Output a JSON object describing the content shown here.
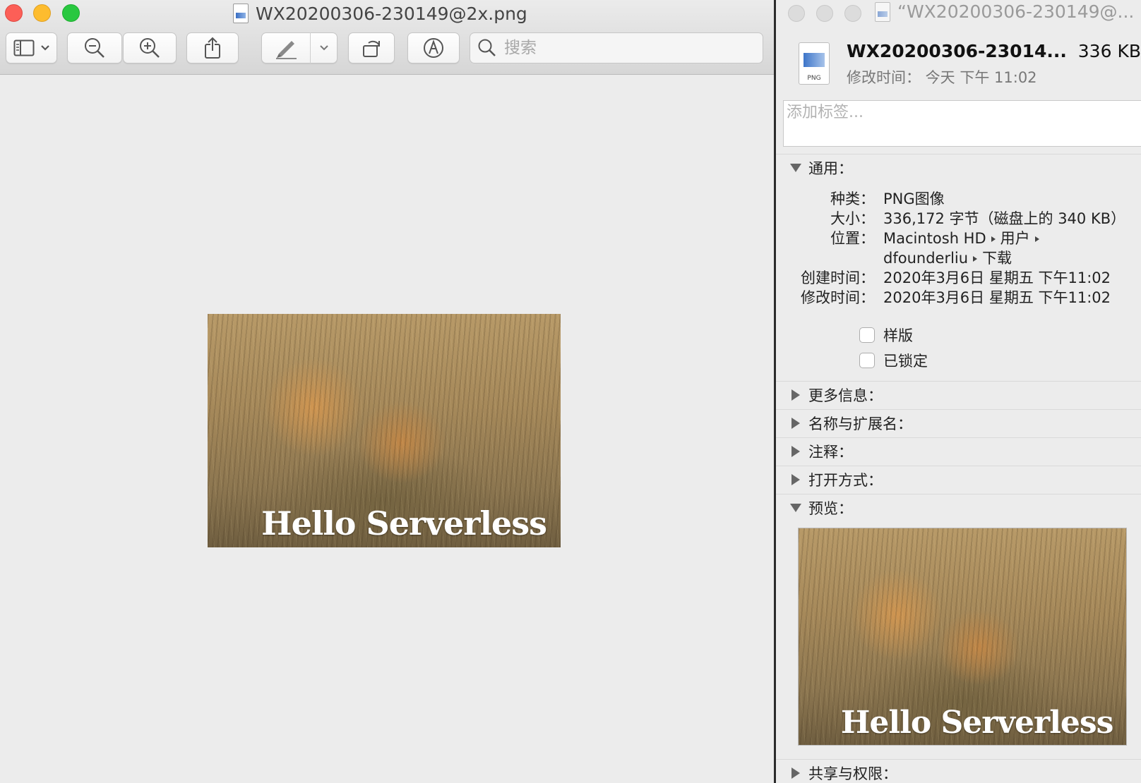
{
  "preview": {
    "title": "WX20200306-230149@2x.png",
    "search_placeholder": "搜索",
    "image_caption": "Hello Serverless",
    "toolbar_icons": [
      "sidebar-toggle-icon",
      "chevron-down-icon",
      "zoom-out-icon",
      "zoom-in-icon",
      "share-icon",
      "markup-pen-icon",
      "chevron-down-icon",
      "rotate-icon",
      "annotate-icon",
      "search-icon"
    ]
  },
  "inspector": {
    "title": "“WX20200306-230149@...",
    "file_name": "WX20200306-23014...",
    "file_size": "336 KB",
    "modified_summary": "修改时间： 今天 下午 11:02",
    "file_badge": "PNG",
    "tags_placeholder": "添加标签...",
    "general": {
      "header": "通用：",
      "kind_label": "种类：",
      "kind_value": "PNG图像",
      "size_label": "大小：",
      "size_value": "336,172 字节（磁盘上的 340 KB）",
      "where_label": "位置：",
      "where_part1": "Macintosh HD",
      "where_part2": "用户",
      "where_part3": "dfounderliu",
      "where_part4": "下载",
      "created_label": "创建时间：",
      "created_value": "2020年3月6日 星期五 下午11:02",
      "modified_label": "修改时间：",
      "modified_value": "2020年3月6日 星期五 下午11:02",
      "stationery_label": "样版",
      "stationery_checked": false,
      "locked_label": "已锁定",
      "locked_checked": false
    },
    "sections": {
      "more_info": "更多信息：",
      "name_ext": "名称与扩展名：",
      "comments": "注释：",
      "open_with": "打开方式：",
      "preview": "预览：",
      "sharing": "共享与权限："
    }
  },
  "colors": {
    "close": "#fc5f57",
    "minimize": "#fdbc2e",
    "zoom": "#29c840",
    "window_bg": "#ececec"
  }
}
